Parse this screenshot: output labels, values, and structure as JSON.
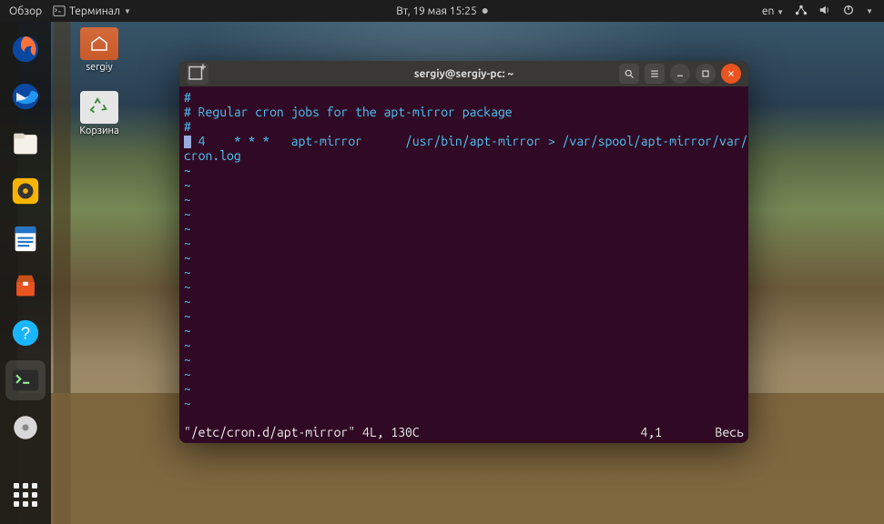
{
  "topbar": {
    "activities": "Обзор",
    "app": "Терминал",
    "datetime": "Вт, 19 мая  15:25",
    "lang": "en"
  },
  "desktop_icons": {
    "home": "sergiy",
    "trash": "Корзина"
  },
  "dock": {
    "items": [
      "firefox",
      "thunderbird",
      "files",
      "rhythmbox",
      "libreoffice-writer",
      "software",
      "help",
      "terminal",
      "disc"
    ]
  },
  "terminal": {
    "title": "sergiy@sergiy-pc: ~",
    "content": {
      "line1": "#",
      "line2": "# Regular cron jobs for the apt-mirror package",
      "line3": "#",
      "line4_num": "0",
      "line4_rest": " 4    * * *   apt-mirror      /usr/bin/apt-mirror > /var/spool/apt-mirror/var/",
      "line5": "cron.log",
      "tilde": "~"
    },
    "status": {
      "file": "\"/etc/cron.d/apt-mirror\" 4L, 130C",
      "pos": "4,1",
      "mode": "Весь"
    }
  }
}
